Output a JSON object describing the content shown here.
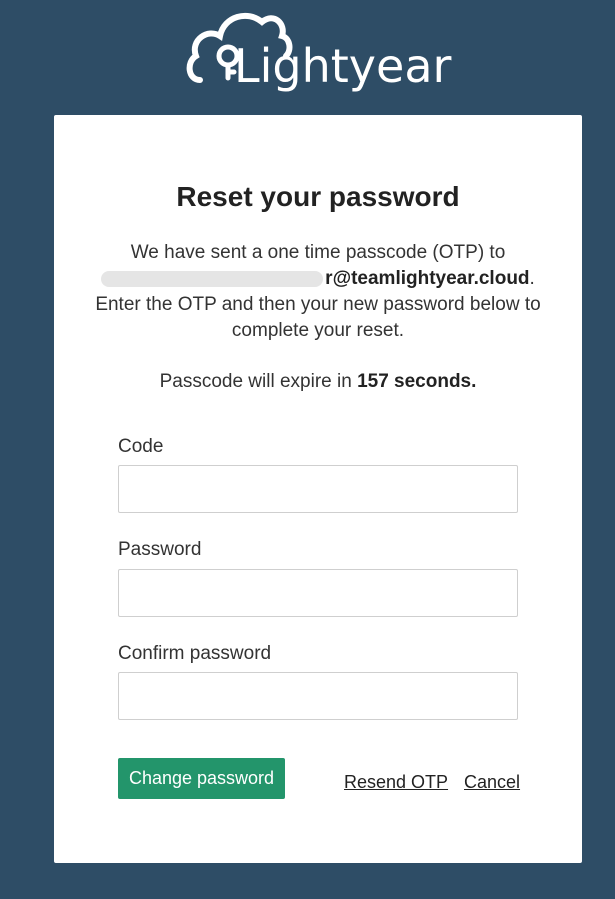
{
  "brand": {
    "name": "Lightyear",
    "logo_icon": "cloud-key-icon"
  },
  "form": {
    "title": "Reset your password",
    "intro_line1": "We have sent a one time passcode (OTP) to",
    "email_visible_tail": "r@teamlightyear.cloud",
    "email_period": ".",
    "intro_line3": "Enter the OTP and then your new password below to complete your reset.",
    "expire_prefix": "Passcode will expire in ",
    "expire_value": "157 seconds.",
    "fields": [
      {
        "label": "Code",
        "value": ""
      },
      {
        "label": "Password",
        "value": ""
      },
      {
        "label": "Confirm password",
        "value": ""
      }
    ],
    "submit_label": "Change password",
    "resend_label": "Resend OTP",
    "cancel_label": "Cancel"
  },
  "colors": {
    "background": "#2e4d66",
    "card": "#ffffff",
    "primary_button": "#23956b"
  }
}
